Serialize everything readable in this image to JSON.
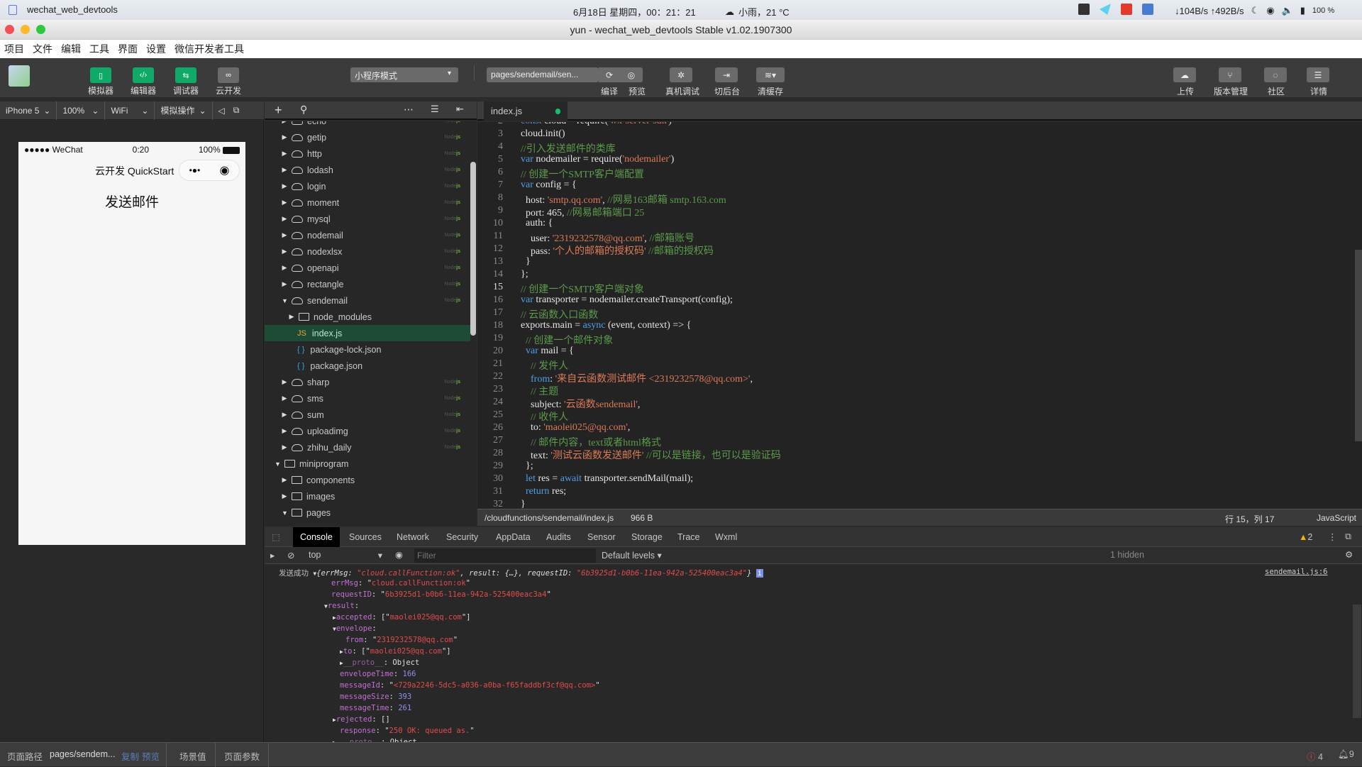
{
  "system": {
    "app_name": "wechat_web_devtools",
    "clock": "6月18日 星期四，00：21：21",
    "weather": "小雨，21 °C",
    "net": "↓104B/s ↑492B/s",
    "battery": "100 %"
  },
  "window": {
    "title": "yun - wechat_web_devtools Stable v1.02.1907300"
  },
  "menu": [
    "项目",
    "文件",
    "编辑",
    "工具",
    "界面",
    "设置",
    "微信开发者工具"
  ],
  "toolbar": {
    "simulator": "模拟器",
    "editor": "编辑器",
    "debugger": "调试器",
    "cloud": "云开发",
    "mode": "小程序模式",
    "page": "pages/sendemail/sen...",
    "compile": "编译",
    "preview": "预览",
    "remote_debug": "真机调试",
    "background": "切后台",
    "clear_cache": "清缓存",
    "upload": "上传",
    "version": "版本管理",
    "community": "社区",
    "details": "详情"
  },
  "simbar": {
    "device": "iPhone 5",
    "zoom": "100%",
    "network": "WiFi",
    "ops": "模拟操作"
  },
  "phone": {
    "carrier": "●●●●● WeChat",
    "time": "0:20",
    "battery": "100%",
    "nav_title": "云开发 QuickStart",
    "heading": "发送邮件"
  },
  "tree": [
    {
      "name": "echo",
      "type": "cloud",
      "depth": 1,
      "open": false,
      "nodejs": true
    },
    {
      "name": "getip",
      "type": "cloud",
      "depth": 1,
      "open": false,
      "nodejs": true
    },
    {
      "name": "http",
      "type": "cloud",
      "depth": 1,
      "open": false,
      "nodejs": true
    },
    {
      "name": "lodash",
      "type": "cloud",
      "depth": 1,
      "open": false,
      "nodejs": true
    },
    {
      "name": "login",
      "type": "cloud",
      "depth": 1,
      "open": false,
      "nodejs": true
    },
    {
      "name": "moment",
      "type": "cloud",
      "depth": 1,
      "open": false,
      "nodejs": true
    },
    {
      "name": "mysql",
      "type": "cloud",
      "depth": 1,
      "open": false,
      "nodejs": true
    },
    {
      "name": "nodemail",
      "type": "cloud",
      "depth": 1,
      "open": false,
      "nodejs": true
    },
    {
      "name": "nodexlsx",
      "type": "cloud",
      "depth": 1,
      "open": false,
      "nodejs": true
    },
    {
      "name": "openapi",
      "type": "cloud",
      "depth": 1,
      "open": false,
      "nodejs": true
    },
    {
      "name": "rectangle",
      "type": "cloud",
      "depth": 1,
      "open": false,
      "nodejs": true
    },
    {
      "name": "sendemail",
      "type": "cloud",
      "depth": 1,
      "open": true,
      "nodejs": true
    },
    {
      "name": "node_modules",
      "type": "folder",
      "depth": 2,
      "open": false
    },
    {
      "name": "index.js",
      "type": "js",
      "depth": 2,
      "selected": true
    },
    {
      "name": "package-lock.json",
      "type": "json",
      "depth": 2
    },
    {
      "name": "package.json",
      "type": "json",
      "depth": 2
    },
    {
      "name": "sharp",
      "type": "cloud",
      "depth": 1,
      "open": false,
      "nodejs": true
    },
    {
      "name": "sms",
      "type": "cloud",
      "depth": 1,
      "open": false,
      "nodejs": true
    },
    {
      "name": "sum",
      "type": "cloud",
      "depth": 1,
      "open": false,
      "nodejs": true
    },
    {
      "name": "uploadimg",
      "type": "cloud",
      "depth": 1,
      "open": false,
      "nodejs": true
    },
    {
      "name": "zhihu_daily",
      "type": "cloud",
      "depth": 1,
      "open": false,
      "nodejs": true
    },
    {
      "name": "miniprogram",
      "type": "folder",
      "depth": 0,
      "open": true
    },
    {
      "name": "components",
      "type": "folder",
      "depth": 1,
      "open": false
    },
    {
      "name": "images",
      "type": "folder",
      "depth": 1,
      "open": false
    },
    {
      "name": "pages",
      "type": "folder",
      "depth": 1,
      "open": true
    }
  ],
  "editor": {
    "tab": "index.js",
    "lines": [
      {
        "n": 2,
        "html": "<span class='kw'>const</span> cloud = require(<span class='str'>'wx-server-sdk'</span>)"
      },
      {
        "n": 3,
        "html": "cloud.init()"
      },
      {
        "n": 4,
        "html": "<span class='cm'>//引入发送邮件的类库</span>"
      },
      {
        "n": 5,
        "html": "<span class='kw'>var</span> nodemailer = require(<span class='str'>'nodemailer'</span>)"
      },
      {
        "n": 6,
        "html": "<span class='cm'>// 创建一个SMTP客户端配置</span>"
      },
      {
        "n": 7,
        "html": "<span class='kw'>var</span> config = {"
      },
      {
        "n": 8,
        "html": "  host: <span class='str'>'smtp.qq.com'</span>, <span class='cm'>//网易163邮箱 smtp.163.com</span>"
      },
      {
        "n": 9,
        "html": "  port: 465, <span class='cm'>//网易邮箱端口 25</span>"
      },
      {
        "n": 10,
        "html": "  auth: {"
      },
      {
        "n": 11,
        "html": "    user: <span class='str'>'2319232578@qq.com'</span>, <span class='cm'>//邮箱账号</span>"
      },
      {
        "n": 12,
        "html": "    pass: <span class='str'>'个人的邮箱的授权码'</span> <span class='cm'>//邮箱的授权码</span>"
      },
      {
        "n": 13,
        "html": "  }"
      },
      {
        "n": 14,
        "html": "};"
      },
      {
        "n": 15,
        "html": "<span class='cm'>// 创建一个SMTP客户端对象</span>"
      },
      {
        "n": 16,
        "html": "<span class='kw'>var</span> transporter = nodemailer.createTransport(config);"
      },
      {
        "n": 17,
        "html": "<span class='cm'>// 云函数入口函数</span>"
      },
      {
        "n": 18,
        "html": "exports.main = <span class='kw'>async</span> (event, context) => {"
      },
      {
        "n": 19,
        "html": "  <span class='cm'>// 创建一个邮件对象</span>"
      },
      {
        "n": 20,
        "html": "  <span class='kw'>var</span> mail = {"
      },
      {
        "n": 21,
        "html": "    <span class='cm'>// 发件人</span>"
      },
      {
        "n": 22,
        "html": "    <span class='kw'>from</span>: <span class='str'>'来自云函数测试邮件 &lt;2319232578@qq.com&gt;'</span>,"
      },
      {
        "n": 23,
        "html": "    <span class='cm'>// 主题</span>"
      },
      {
        "n": 24,
        "html": "    subject: <span class='str'>'云函数sendemail'</span>,"
      },
      {
        "n": 25,
        "html": "    <span class='cm'>// 收件人</span>"
      },
      {
        "n": 26,
        "html": "    to: <span class='str'>'maolei025@qq.com'</span>,"
      },
      {
        "n": 27,
        "html": "    <span class='cm'>// 邮件内容，text或者html格式</span>"
      },
      {
        "n": 28,
        "html": "    text: <span class='str'>'测试云函数发送邮件'</span> <span class='cm'>//可以是链接，也可以是验证码</span>"
      },
      {
        "n": 29,
        "html": "  };"
      },
      {
        "n": 30,
        "html": "  <span class='kw'>let</span> res = <span class='kw'>await</span> transporter.sendMail(mail);"
      },
      {
        "n": 31,
        "html": "  <span class='kw'>return</span> res;"
      },
      {
        "n": 32,
        "html": "}"
      }
    ],
    "status": {
      "path": "/cloudfunctions/sendemail/index.js",
      "size": "966 B",
      "position": "行 15，列 17",
      "language": "JavaScript"
    }
  },
  "devtools": {
    "tabs": [
      "Console",
      "Sources",
      "Network",
      "Security",
      "AppData",
      "Audits",
      "Sensor",
      "Storage",
      "Trace",
      "Wxml"
    ],
    "active_tab": "Console",
    "warnings": "2",
    "context": "top",
    "filter_placeholder": "Filter",
    "levels": "Default levels ▾",
    "hidden": "1 hidden",
    "source_link": "sendemail.js:6",
    "log_label": "发送成功"
  },
  "bottom": {
    "path_label": "页面路径",
    "path": "pages/sendem...",
    "copy": "复制",
    "preview": "预览",
    "scene": "场景值",
    "params": "页面参数",
    "errors": "4",
    "notifications": "9"
  }
}
